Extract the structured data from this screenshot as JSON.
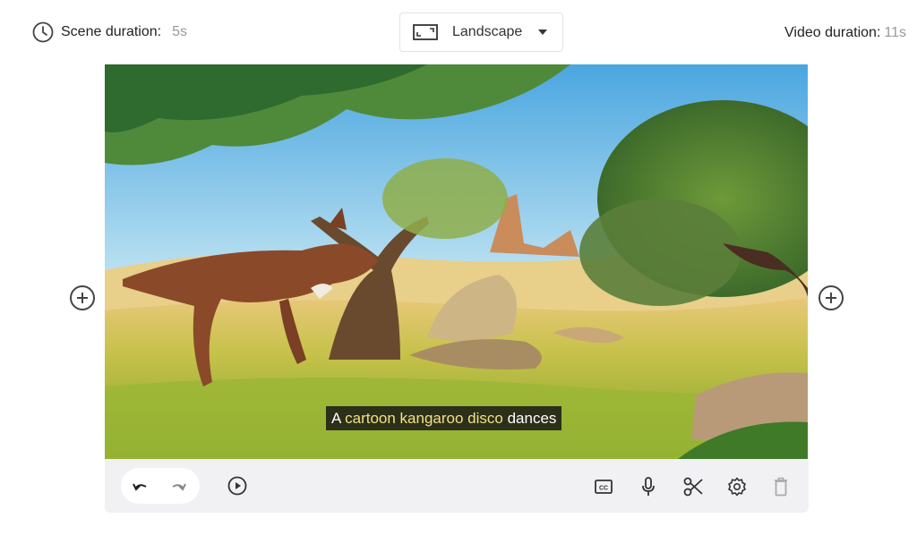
{
  "header": {
    "scene_duration_label": "Scene duration:",
    "scene_duration_value": "5s",
    "orientation_selected": "Landscape",
    "video_duration_label": "Video duration:",
    "video_duration_value": "11s"
  },
  "scene": {
    "caption_before": "A ",
    "caption_highlight": "cartoon kangaroo disco",
    "caption_after": " dances"
  },
  "toolbar": {
    "icons": [
      "undo-icon",
      "redo-icon",
      "play-icon",
      "closed-captions-icon",
      "microphone-icon",
      "scissors-icon",
      "settings-icon",
      "trash-icon"
    ]
  },
  "colors": {
    "toolbar_bg": "#f1f1f4",
    "caption_highlight": "#f0e08a",
    "muted_text": "#999999"
  }
}
